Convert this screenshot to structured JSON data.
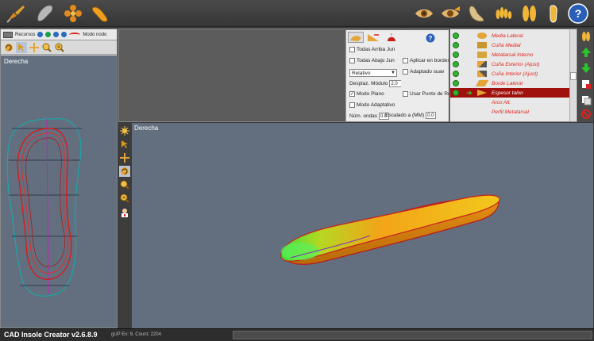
{
  "app": {
    "title": "CAD Insole Creator v2.6.8.9",
    "status_text": "gUP Ev: 9, Count: 2204"
  },
  "toolbar": {
    "left_tools": [
      "draw-pencil-icon",
      "insole-shape-icon",
      "flower-pattern-icon",
      "sole-outline-icon"
    ],
    "right_tools": [
      "eye-view-icon",
      "eye-foot-icon",
      "foot-3d-icon",
      "toes-icon",
      "insole-pair-icon",
      "insole-single-icon",
      "help-icon"
    ]
  },
  "left_panel": {
    "recursos_label": "Recursos",
    "modo_nodo_label": "Modo nodo",
    "view_label": "Derecha"
  },
  "params": {
    "todas_arriba": "Todas Arriba Jun",
    "todas_abajo": "Todas Abajo Jun",
    "aplicar_bordes": "Aplicar en bordes",
    "select_value": "Relativo",
    "adaptado": "Adaptado suav",
    "desplaz_label": "Desplaz. Módulo",
    "desplaz_value": "2.0",
    "modo_plano": "Modo Plano",
    "usar_punto": "Usar Punto de Re",
    "modo_adaptativo": "Modo Adaptativo",
    "num_ondas_label": "Núm. ondas",
    "num_ondas_value": "0.0",
    "escalado_label": "Escalado a (MM)",
    "escalado_value": "0.0"
  },
  "layers": [
    {
      "label": "Media Lateral",
      "checked": true,
      "selected": false
    },
    {
      "label": "Cuña Medial",
      "checked": true,
      "selected": false
    },
    {
      "label": "Metatarsal Interno",
      "checked": true,
      "selected": false
    },
    {
      "label": "Cuña Exterior (Ajust)",
      "checked": true,
      "selected": false
    },
    {
      "label": "Cuña Interior (Ajust)",
      "checked": true,
      "selected": false
    },
    {
      "label": "Borde Lateral",
      "checked": true,
      "selected": false
    },
    {
      "label": "Espesor talon",
      "checked": true,
      "selected": true
    },
    {
      "label": "Arco Alt.",
      "checked": false,
      "selected": false
    },
    {
      "label": "Perfil Metatarsal",
      "checked": false,
      "selected": false
    }
  ],
  "main_view": {
    "view_label": "Derecha"
  },
  "colors": {
    "viewport_bg": "#636f7f",
    "outline_cyan": "#18a7a8",
    "outline_red": "#d81b1b",
    "axis_magenta": "#c020c0",
    "selected_row": "#a0110e",
    "layer_text": "#e0241c"
  }
}
